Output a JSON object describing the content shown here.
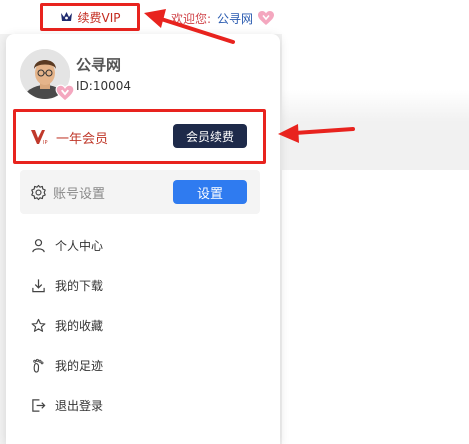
{
  "topbar": {
    "vip_link": "续费VIP",
    "welcome_text": "欢迎您:",
    "username": "公寻网"
  },
  "profile": {
    "name": "公寻网",
    "id_text": "ID:10004"
  },
  "membership": {
    "label": "一年会员",
    "renew_button": "会员续费"
  },
  "account": {
    "label": "账号设置",
    "settings_button": "设置"
  },
  "menu": [
    {
      "label": "个人中心",
      "icon": "user-icon"
    },
    {
      "label": "我的下载",
      "icon": "download-icon"
    },
    {
      "label": "我的收藏",
      "icon": "star-icon"
    },
    {
      "label": "我的足迹",
      "icon": "footprint-icon"
    },
    {
      "label": "退出登录",
      "icon": "logout-icon"
    }
  ],
  "colors": {
    "highlight": "#e8231e",
    "renew_button": "#1e2a4a",
    "settings_button": "#2f7bf0",
    "heart": "#f4a7bf"
  }
}
